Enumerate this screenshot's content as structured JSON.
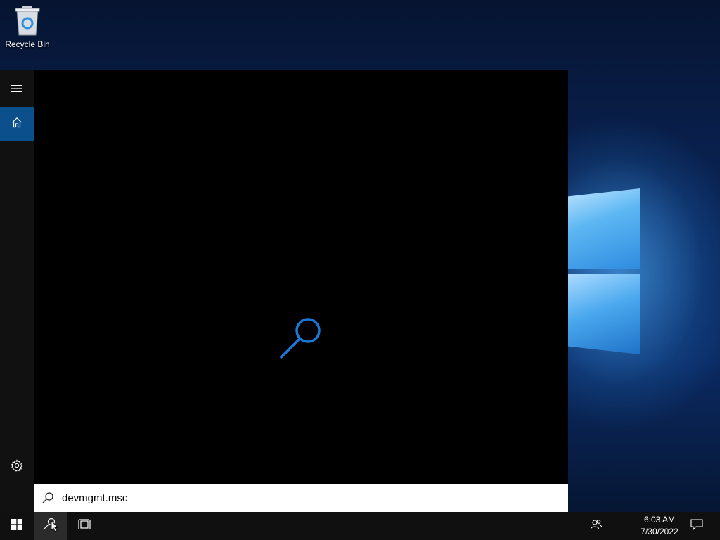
{
  "desktop": {
    "icons": [
      {
        "label": "Recycle Bin",
        "icon": "recycle-bin-icon"
      }
    ]
  },
  "start_menu": {
    "rail": {
      "menu_icon": "hamburger-icon",
      "home_icon": "home-icon",
      "settings_icon": "gear-icon"
    },
    "loading_icon": "search-icon",
    "search": {
      "value": "devmgmt.msc",
      "icon": "search-icon"
    }
  },
  "taskbar": {
    "start_icon": "windows-logo-icon",
    "search_icon": "search-cursor-icon",
    "task_view_icon": "task-view-icon",
    "people_icon": "people-icon",
    "clock": {
      "time": "6:03 AM",
      "date": "7/30/2022"
    },
    "notification_icon": "action-center-icon"
  },
  "colors": {
    "accent": "#0b4f8c",
    "search_loader": "#1a78d8",
    "taskbar": "#101010",
    "start_bg": "#000000"
  }
}
